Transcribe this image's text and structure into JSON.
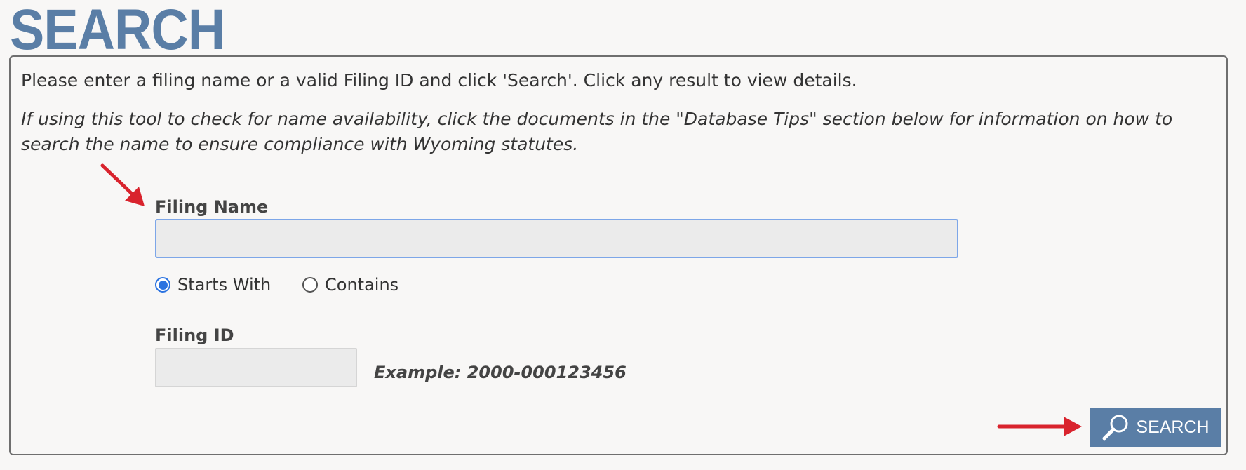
{
  "page": {
    "title": "SEARCH"
  },
  "instructions": {
    "intro": "Please enter a filing name or a valid Filing ID and click 'Search'. Click any result to view details.",
    "tip": "If using this tool to check for name availability, click the documents in the \"Database Tips\" section below for information on how to search the name to ensure compliance with Wyoming statutes."
  },
  "form": {
    "filing_name": {
      "label": "Filing Name",
      "value": ""
    },
    "match_mode": {
      "selected": "Starts With",
      "options": [
        "Starts With",
        "Contains"
      ]
    },
    "filing_id": {
      "label": "Filing ID",
      "value": "",
      "example": "Example: 2000-000123456"
    },
    "search_button_label": "SEARCH"
  },
  "icons": {
    "search_button_icon": "magnifier-icon",
    "annotation_arrows": [
      "arrow-icon",
      "arrow-icon"
    ]
  },
  "colors": {
    "brand": "#5a7ea6",
    "focus_border": "#7da6e8",
    "radio_selected": "#2a72e0",
    "annotation_arrow": "#d9232d"
  }
}
